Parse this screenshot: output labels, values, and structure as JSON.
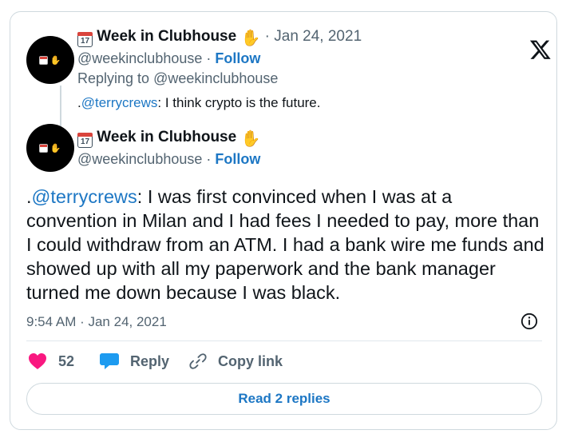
{
  "parent_tweet": {
    "display_name": "Week in Clubhouse",
    "handle": "@weekinclubhouse",
    "separator": "·",
    "date": "Jan 24, 2021",
    "follow_label": "Follow",
    "replying_prefix": "Replying to",
    "replying_handle": "@weekinclubhouse",
    "text_prefix": ".",
    "text_mention": "@terrycrews",
    "text_body": ": I think crypto is the future."
  },
  "main_tweet": {
    "display_name": "Week in Clubhouse",
    "handle": "@weekinclubhouse",
    "separator": "·",
    "follow_label": "Follow",
    "text_prefix": ".",
    "text_mention": "@terrycrews",
    "text_body": ": I was first convinced when I was at a convention in Milan and I had fees I needed to pay, more than I could withdraw from an ATM. I had a bank wire me funds and showed up with all my paperwork and the bank manager turned me down because I was black.",
    "timestamp": "9:54 AM · Jan 24, 2021"
  },
  "actions": {
    "like_count": "52",
    "reply_label": "Reply",
    "copy_link_label": "Copy link"
  },
  "footer": {
    "read_replies_label": "Read 2 replies"
  },
  "icons": {
    "logo": "x-logo-icon",
    "calendar": "calendar-emoji-icon",
    "wave": "waving-hand-emoji-icon",
    "like": "heart-icon",
    "reply": "speech-bubble-icon",
    "copy_link": "link-icon",
    "info": "info-icon"
  },
  "colors": {
    "link": "#1d77c4",
    "like": "#f91880",
    "muted": "#536471",
    "border": "#cfd9de"
  }
}
